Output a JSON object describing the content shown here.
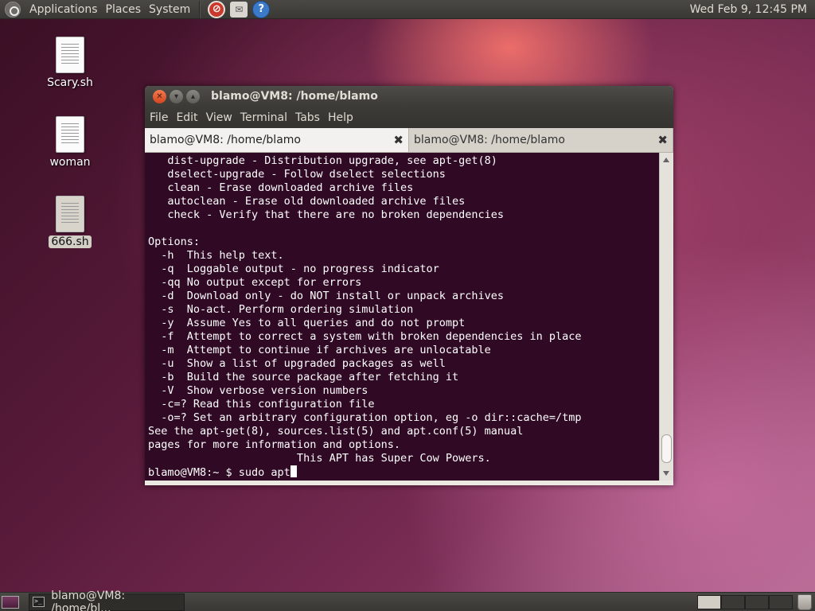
{
  "top_panel": {
    "menus": [
      "Applications",
      "Places",
      "System"
    ],
    "clock": "Wed Feb  9, 12:45 PM"
  },
  "desktop_icons": [
    {
      "label": "Scary.sh"
    },
    {
      "label": "woman"
    },
    {
      "label": "666.sh",
      "selected": true
    }
  ],
  "window": {
    "title": "blamo@VM8: /home/blamo",
    "menu": [
      "File",
      "Edit",
      "View",
      "Terminal",
      "Tabs",
      "Help"
    ],
    "tabs": [
      {
        "label": "blamo@VM8: /home/blamo",
        "active": true
      },
      {
        "label": "blamo@VM8: /home/blamo",
        "active": false
      }
    ],
    "terminal_lines": [
      "   dist-upgrade - Distribution upgrade, see apt-get(8)",
      "   dselect-upgrade - Follow dselect selections",
      "   clean - Erase downloaded archive files",
      "   autoclean - Erase old downloaded archive files",
      "   check - Verify that there are no broken dependencies",
      "",
      "Options:",
      "  -h  This help text.",
      "  -q  Loggable output - no progress indicator",
      "  -qq No output except for errors",
      "  -d  Download only - do NOT install or unpack archives",
      "  -s  No-act. Perform ordering simulation",
      "  -y  Assume Yes to all queries and do not prompt",
      "  -f  Attempt to correct a system with broken dependencies in place",
      "  -m  Attempt to continue if archives are unlocatable",
      "  -u  Show a list of upgraded packages as well",
      "  -b  Build the source package after fetching it",
      "  -V  Show verbose version numbers",
      "  -c=? Read this configuration file",
      "  -o=? Set an arbitrary configuration option, eg -o dir::cache=/tmp",
      "See the apt-get(8), sources.list(5) and apt.conf(5) manual",
      "pages for more information and options.",
      "                       This APT has Super Cow Powers."
    ],
    "prompt": "blamo@VM8:~ $ sudo apt"
  },
  "bottom_panel": {
    "task_label": "blamo@VM8: /home/bl..."
  },
  "colors": {
    "terminal_bg": "#300a24",
    "terminal_fg": "#ffffff",
    "panel_bg": "#3c3b37",
    "close_button": "#e05a2b"
  },
  "icons": {
    "top": [
      "ubuntu-logo-icon",
      "no-entry-icon",
      "mail-icon",
      "help-icon"
    ],
    "bottom": [
      "show-desktop-icon",
      "terminal-icon",
      "trash-icon"
    ]
  }
}
